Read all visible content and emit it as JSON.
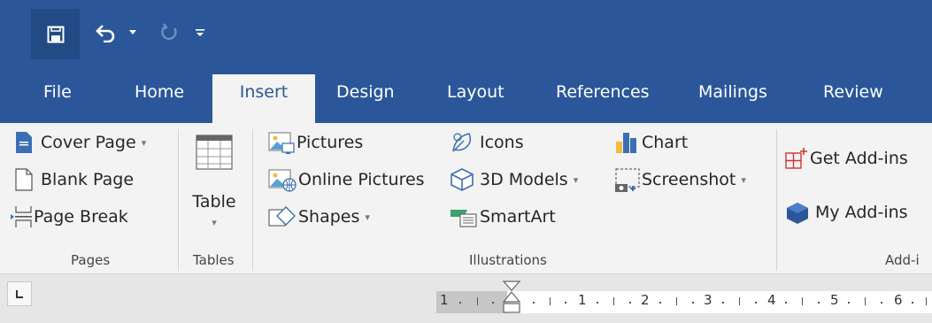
{
  "window": {
    "quick_access": {
      "save_icon": "save-icon",
      "undo_icon": "undo-icon",
      "redo_icon": "redo-icon",
      "customize_icon": "customize-qat-icon"
    },
    "accent_color": "#2b579a"
  },
  "tabs": [
    {
      "label": "File"
    },
    {
      "label": "Home"
    },
    {
      "label": "Insert",
      "active": true
    },
    {
      "label": "Design"
    },
    {
      "label": "Layout"
    },
    {
      "label": "References"
    },
    {
      "label": "Mailings"
    },
    {
      "label": "Review"
    }
  ],
  "ribbon": {
    "pages": {
      "cover_page": "Cover Page",
      "blank_page": "Blank Page",
      "page_break": "Page Break",
      "label": "Pages"
    },
    "tables": {
      "table": "Table",
      "label": "Tables"
    },
    "illustrations": {
      "pictures": "Pictures",
      "online_pictures": "Online Pictures",
      "shapes": "Shapes",
      "icons": "Icons",
      "models_3d": "3D Models",
      "smartart": "SmartArt",
      "chart": "Chart",
      "screenshot": "Screenshot",
      "label": "Illustrations"
    },
    "addins": {
      "get_addins": "Get Add-ins",
      "my_addins": "My Add-ins",
      "label": "Add-i"
    }
  },
  "ruler": {
    "numbers": [
      "1",
      "1",
      "2",
      "3",
      "4",
      "5",
      "6"
    ]
  }
}
